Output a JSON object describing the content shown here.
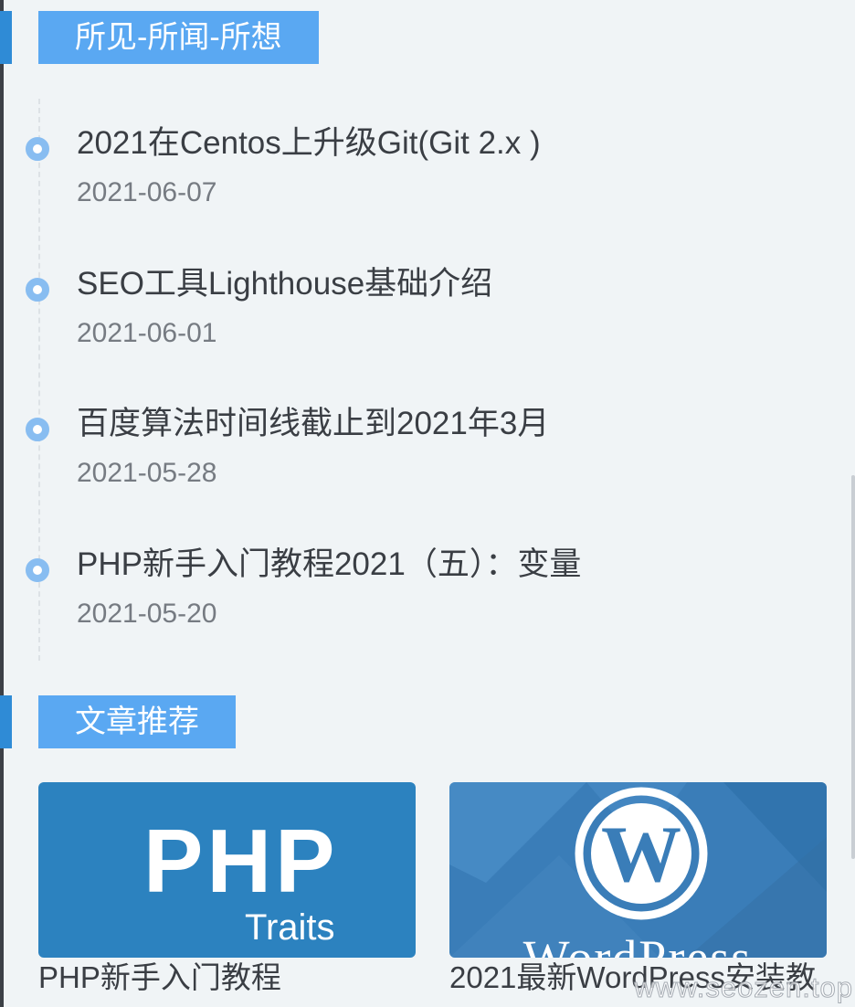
{
  "section_timeline": {
    "title": "所见-所闻-所想"
  },
  "posts": [
    {
      "title": "2021在Centos上升级Git(Git 2.x )",
      "date": "2021-06-07"
    },
    {
      "title": "SEO工具Lighthouse基础介绍",
      "date": "2021-06-01"
    },
    {
      "title": "百度算法时间线截止到2021年3月",
      "date": "2021-05-28"
    },
    {
      "title": "PHP新手入门教程2021（五）：变量",
      "date": "2021-05-20"
    }
  ],
  "section_recommend": {
    "title": "文章推荐"
  },
  "recommend": [
    {
      "title": "PHP新手入门教程",
      "image_text": "PHP",
      "image_subtext": "Traits",
      "icon": "php-logo",
      "color": "#2c82bf"
    },
    {
      "title": "2021最新WordPress安装教",
      "image_text": "WordPress",
      "icon": "wordpress-logo",
      "color": "#3a7db8"
    }
  ],
  "watermark": "www.seozen.top",
  "colors": {
    "accent": "#5aa8f2",
    "accent_dark": "#2f8bd6",
    "dot": "#88bdf1",
    "background": "#f0f4f6"
  }
}
